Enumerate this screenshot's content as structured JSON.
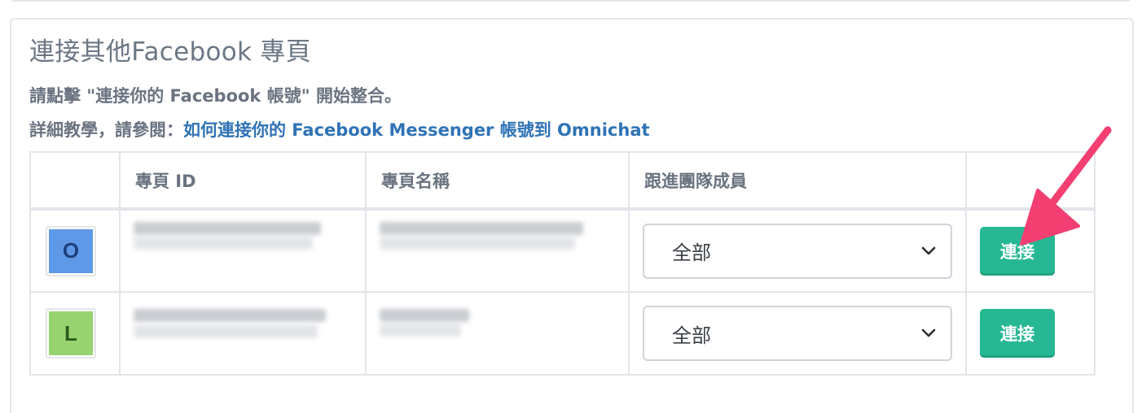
{
  "section": {
    "title": "連接其他Facebook 專頁",
    "instruction": "請點擊 \"連接你的 Facebook 帳號\" 開始整合。",
    "tutorial_prefix": "詳細教學，請參閱：",
    "tutorial_link": "如何連接你的 Facebook Messenger 帳號到 Omnichat"
  },
  "table": {
    "columns": [
      "",
      "專頁 ID",
      "專頁名稱",
      "跟進團隊成員",
      ""
    ],
    "rows": [
      {
        "avatar_letter": "O",
        "team_member": "全部",
        "action_label": "連接"
      },
      {
        "avatar_letter": "L",
        "team_member": "全部",
        "action_label": "連接"
      }
    ]
  },
  "colors": {
    "accent_button": "#27b893",
    "link": "#2f73b6",
    "annotation_arrow": "#f33f72",
    "avatar_blue": "#5f98e6",
    "avatar_green": "#97d470"
  }
}
